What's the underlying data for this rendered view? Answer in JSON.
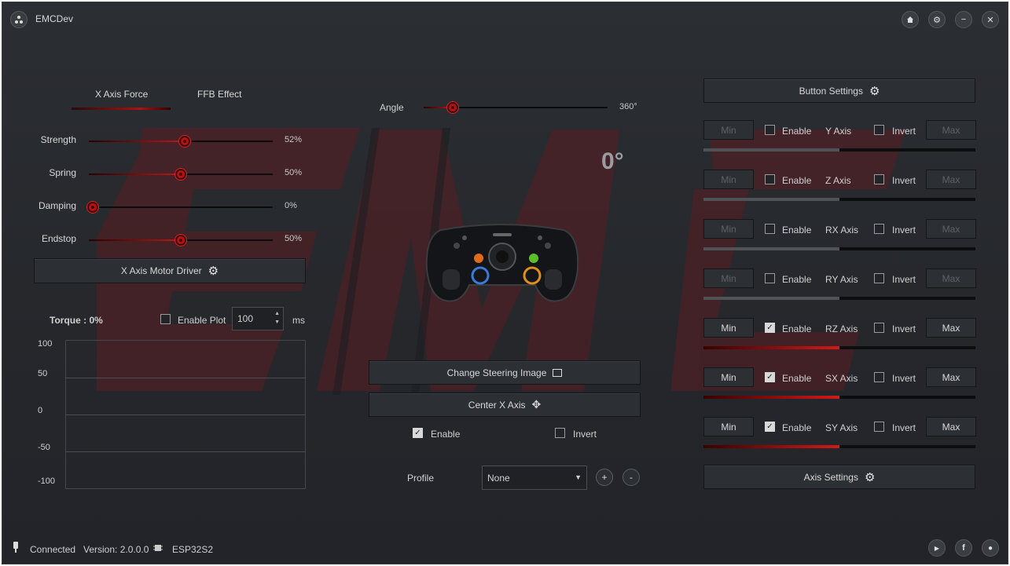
{
  "window": {
    "title": "EMCDev"
  },
  "tabs": [
    {
      "label": "X Axis Force",
      "active": true
    },
    {
      "label": "FFB Effect",
      "active": false
    }
  ],
  "sliders": [
    {
      "label": "Strength",
      "value": 52,
      "value_text": "52%"
    },
    {
      "label": "Spring",
      "value": 50,
      "value_text": "50%"
    },
    {
      "label": "Damping",
      "value": 0,
      "value_text": "0%"
    },
    {
      "label": "Endstop",
      "value": 50,
      "value_text": "50%"
    }
  ],
  "motor_driver_button": "X Axis Motor Driver",
  "torque": {
    "label": "Torque : 0%",
    "enable_plot_label": "Enable Plot",
    "enable_plot_checked": false,
    "interval_value": "100",
    "interval_unit": "ms",
    "plot_yticks": [
      "100",
      "50",
      "0",
      "-50",
      "-100"
    ]
  },
  "angle": {
    "label": "Angle",
    "value_text": "360°",
    "fraction": 0.16
  },
  "current_angle": "0°",
  "steering": {
    "change_image_button": "Change Steering Image",
    "center_button": "Center X Axis",
    "enable_label": "Enable",
    "enable_checked": true,
    "invert_label": "Invert",
    "invert_checked": false
  },
  "profile": {
    "label": "Profile",
    "selected": "None",
    "add": "+",
    "remove": "-"
  },
  "button_settings": "Button Settings",
  "axis_settings": "Axis Settings",
  "axes": [
    {
      "name": "Y Axis",
      "min": "Min",
      "max": "Max",
      "enable_label": "Enable",
      "enabled": false,
      "invert_label": "Invert",
      "inverted": false,
      "level": 0.5
    },
    {
      "name": "Z Axis",
      "min": "Min",
      "max": "Max",
      "enable_label": "Enable",
      "enabled": false,
      "invert_label": "Invert",
      "inverted": false,
      "level": 0.5
    },
    {
      "name": "RX Axis",
      "min": "Min",
      "max": "Max",
      "enable_label": "Enable",
      "enabled": false,
      "invert_label": "Invert",
      "inverted": false,
      "level": 0.5
    },
    {
      "name": "RY Axis",
      "min": "Min",
      "max": "Max",
      "enable_label": "Enable",
      "enabled": false,
      "invert_label": "Invert",
      "inverted": false,
      "level": 0.5
    },
    {
      "name": "RZ Axis",
      "min": "Min",
      "max": "Max",
      "enable_label": "Enable",
      "enabled": true,
      "invert_label": "Invert",
      "inverted": false,
      "level": 0.5
    },
    {
      "name": "SX Axis",
      "min": "Min",
      "max": "Max",
      "enable_label": "Enable",
      "enabled": true,
      "invert_label": "Invert",
      "inverted": false,
      "level": 0.5
    },
    {
      "name": "SY Axis",
      "min": "Min",
      "max": "Max",
      "enable_label": "Enable",
      "enabled": true,
      "invert_label": "Invert",
      "inverted": false,
      "level": 0.5
    }
  ],
  "status": {
    "connection": "Connected",
    "version": "Version: 2.0.0.0",
    "chip": "ESP32S2"
  },
  "colors": {
    "accent": "#c01818",
    "background": "#26282d"
  }
}
